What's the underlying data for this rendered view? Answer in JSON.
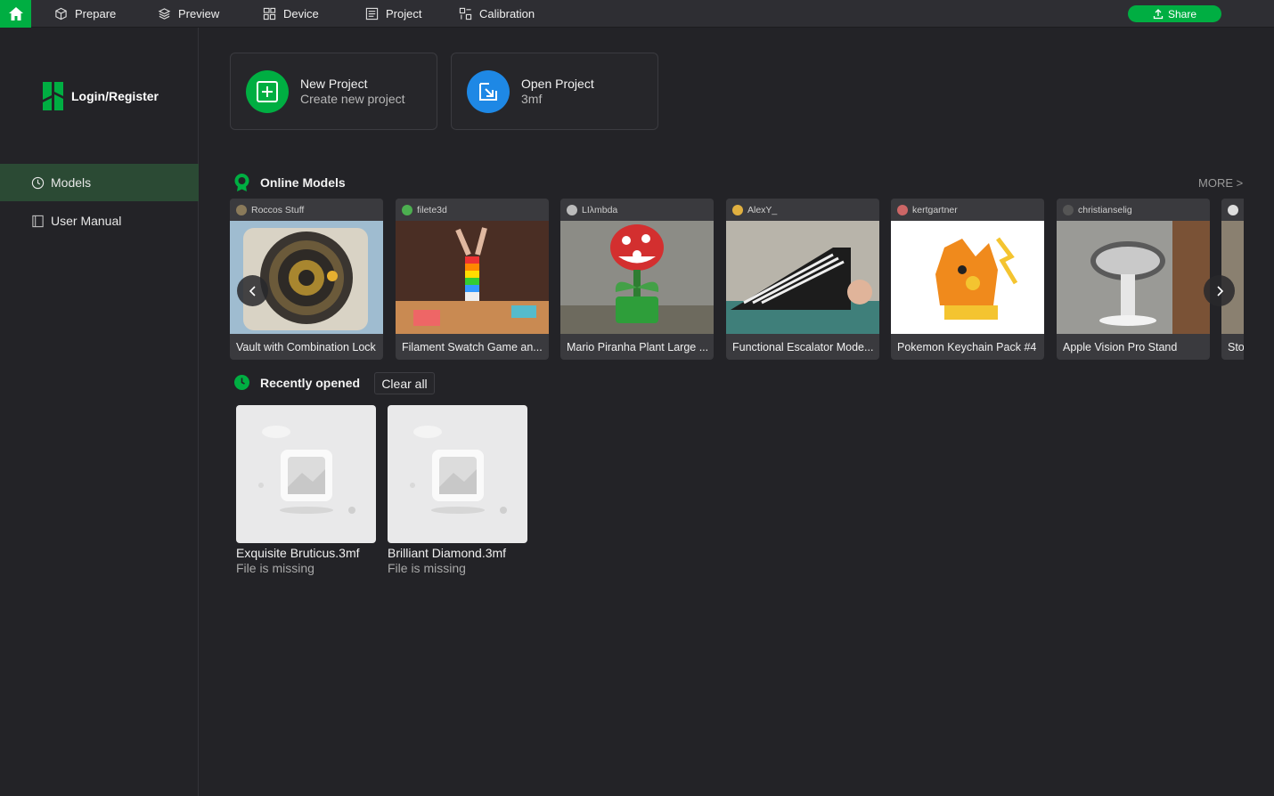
{
  "topbar": {
    "nav": [
      {
        "label": "Prepare",
        "icon": "cube-icon"
      },
      {
        "label": "Preview",
        "icon": "layers-icon"
      },
      {
        "label": "Device",
        "icon": "device-icon"
      },
      {
        "label": "Project",
        "icon": "project-icon"
      },
      {
        "label": "Calibration",
        "icon": "calibration-icon"
      }
    ],
    "share_label": "Share",
    "accent": "#00ae42"
  },
  "sidebar": {
    "login_label": "Login/Register",
    "items": [
      {
        "label": "Models",
        "icon": "clock-icon",
        "active": true
      },
      {
        "label": "User Manual",
        "icon": "book-icon",
        "active": false
      }
    ]
  },
  "projects": {
    "new": {
      "title": "New Project",
      "subtitle": "Create new project"
    },
    "open": {
      "title": "Open Project",
      "subtitle": "3mf"
    }
  },
  "online_models": {
    "heading": "Online Models",
    "more_label": "MORE >",
    "items": [
      {
        "author": "Roccos Stuff",
        "title": "Vault with Combination Lock"
      },
      {
        "author": "filete3d",
        "title": "Filament Swatch Game an..."
      },
      {
        "author": "LIλmbda",
        "title": "Mario Piranha Plant Large ..."
      },
      {
        "author": "AlexY_",
        "title": "Functional Escalator Mode..."
      },
      {
        "author": "kertgartner",
        "title": "Pokemon Keychain Pack #4"
      },
      {
        "author": "christianselig",
        "title": "Apple Vision Pro Stand"
      },
      {
        "author": "",
        "title": "Sto"
      }
    ]
  },
  "recent": {
    "heading": "Recently opened",
    "clear_label": "Clear all",
    "items": [
      {
        "name": "Exquisite Bruticus.3mf",
        "status": "File is missing"
      },
      {
        "name": "Brilliant Diamond.3mf",
        "status": "File is missing"
      }
    ]
  }
}
